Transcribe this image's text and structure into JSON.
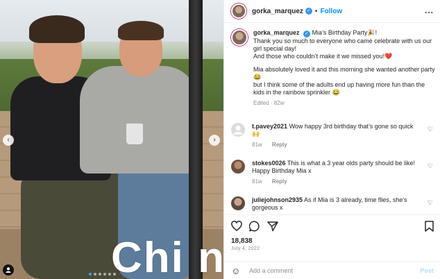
{
  "photo": {
    "watermark": "Chi n",
    "prev_arrow": "‹",
    "next_arrow": "›",
    "tag_icon": "user-tag-icon"
  },
  "header": {
    "username": "gorka_marquez",
    "verified_icon": "verified-badge-icon",
    "separator": "•",
    "follow": "Follow",
    "more": "..."
  },
  "caption": {
    "username": "gorka_marquez",
    "lines": [
      "Mia’s Birthday Party🎉!",
      "Thank you so much to everyone who came celebrate with us our girl special day!",
      "And those who couldn’t make it we missed you!❤️",
      "Mia absolutely loved it and this morning she wanted another party😂",
      "but I think some of the adults end up having more fun than the kids in the rainbow sprinkler 😂"
    ],
    "meta": "Edited · 82w"
  },
  "comments": [
    {
      "username": "t.pavey2021",
      "text": "Wow happy 3rd birthday that’s gone so quick 🙌",
      "time": "81w",
      "reply": "Reply"
    },
    {
      "username": "stokes0026",
      "text": "This is what a 3 year olds party should be like! Happy Birthday Mia x",
      "time": "81w",
      "reply": "Reply"
    },
    {
      "username": "juliejohnson2935",
      "text": "As if Mia is 3 already, time flies, she's gorgeous x",
      "time": "",
      "reply": ""
    }
  ],
  "actions": {
    "like_icon": "heart-icon",
    "comment_icon": "comment-icon",
    "share_icon": "share-icon",
    "save_icon": "bookmark-icon",
    "likes": "18,838",
    "date": "July 4, 2022"
  },
  "add_comment": {
    "placeholder": "Add a comment",
    "post": "Post",
    "emoji_icon": "emoji-icon"
  },
  "colors": {
    "accent": "#0095f6",
    "verified": "#3897f0",
    "muted": "#8e8e8e",
    "post_disabled": "#b2dffc"
  }
}
